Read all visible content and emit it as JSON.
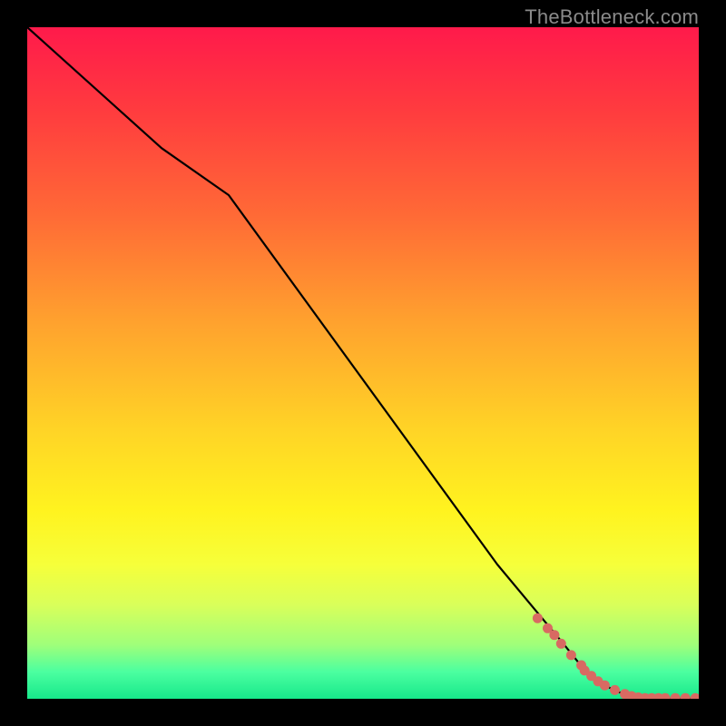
{
  "watermark": "TheBottleneck.com",
  "colors": {
    "marker": "#d86a62",
    "line": "#000000",
    "frame": "#000000"
  },
  "chart_data": {
    "type": "line",
    "title": "",
    "xlabel": "",
    "ylabel": "",
    "xlim": [
      0,
      100
    ],
    "ylim": [
      0,
      100
    ],
    "grid": false,
    "legend": false,
    "series": [
      {
        "name": "curve",
        "x": [
          0,
          20,
          30,
          70,
          80,
          84,
          88,
          92,
          100
        ],
        "values": [
          100,
          82,
          75,
          20,
          8,
          3,
          1,
          0,
          0
        ]
      }
    ],
    "markers": {
      "name": "scatter-points",
      "x": [
        76,
        77.5,
        78.5,
        79.5,
        81,
        82.5,
        83,
        84,
        85,
        86,
        87.5,
        89,
        90,
        91,
        92,
        93,
        94,
        95,
        96.5,
        98,
        99.5
      ],
      "values": [
        12,
        10.5,
        9.5,
        8.2,
        6.5,
        5,
        4.2,
        3.4,
        2.6,
        2,
        1.3,
        0.7,
        0.4,
        0.2,
        0.1,
        0.1,
        0.1,
        0.1,
        0.1,
        0.1,
        0.1
      ]
    }
  }
}
